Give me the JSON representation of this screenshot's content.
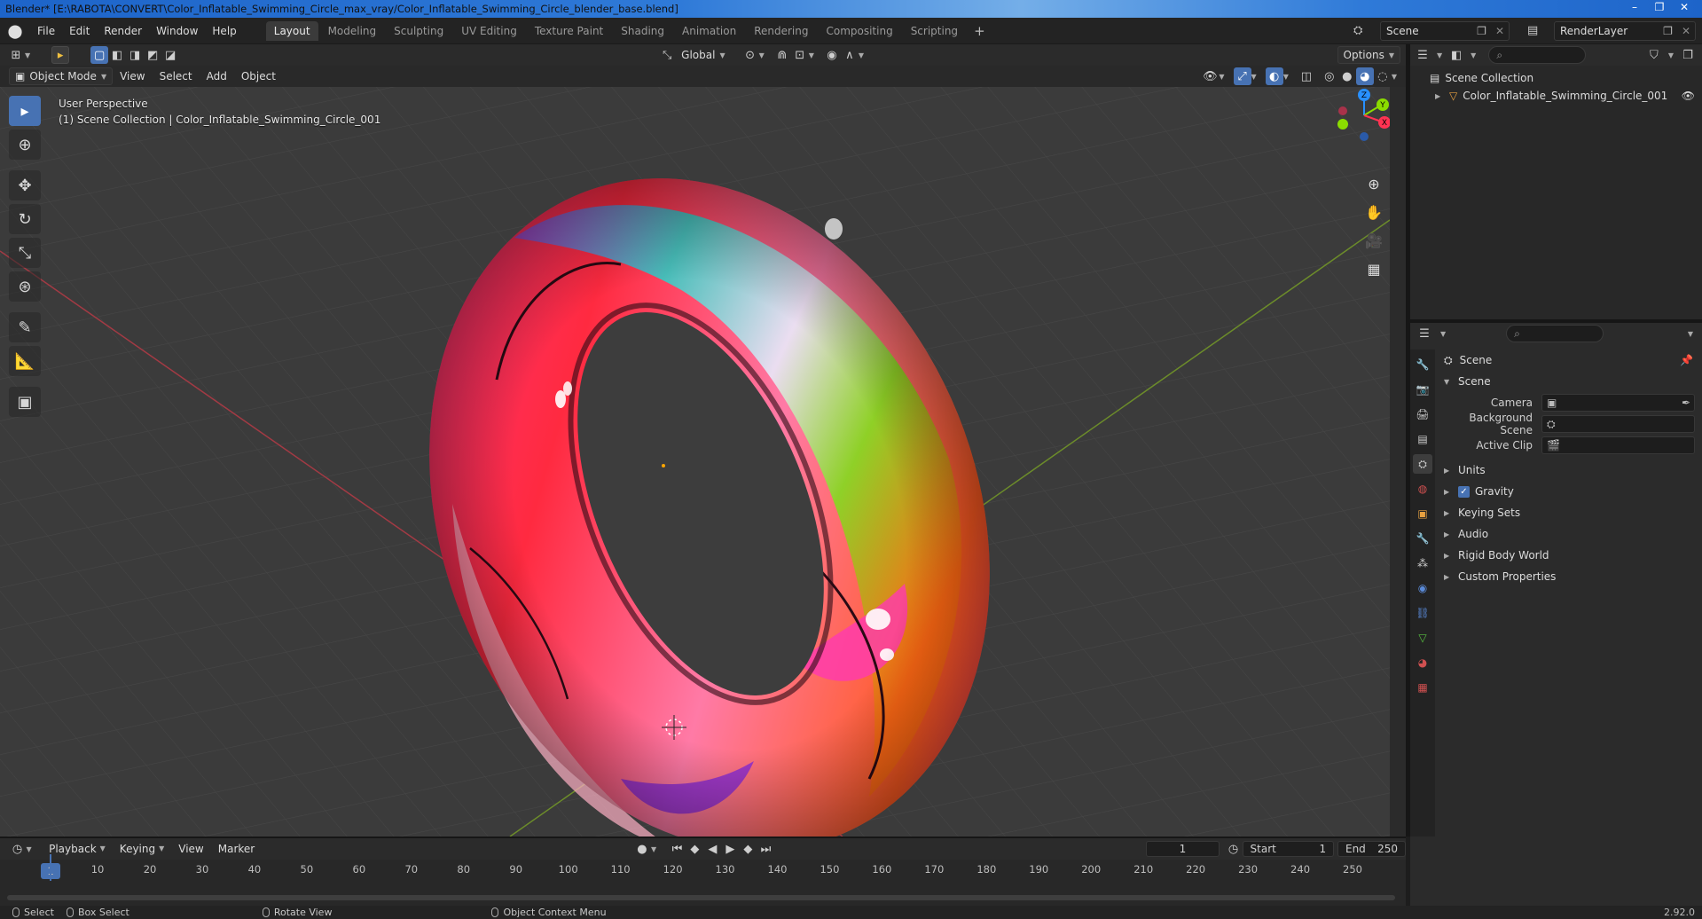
{
  "window": {
    "title": "Blender* [E:\\RABOTA\\CONVERT\\Color_Inflatable_Swimming_Circle_max_vray/Color_Inflatable_Swimming_Circle_blender_base.blend]",
    "min": "–",
    "max": "❐",
    "close": "✕"
  },
  "menu": [
    "File",
    "Edit",
    "Render",
    "Window",
    "Help"
  ],
  "workspaces": [
    "Layout",
    "Modeling",
    "Sculpting",
    "UV Editing",
    "Texture Paint",
    "Shading",
    "Animation",
    "Rendering",
    "Compositing",
    "Scripting"
  ],
  "active_workspace": "Layout",
  "scene_name": "Scene",
  "view_layer": "RenderLayer",
  "toolbar": {
    "orientation": "Global",
    "options": "Options"
  },
  "viewport_header": {
    "mode": "Object Mode",
    "menus": [
      "View",
      "Select",
      "Add",
      "Object"
    ]
  },
  "viewport": {
    "perspective": "User Perspective",
    "collection_info": "(1) Scene Collection | Color_Inflatable_Swimming_Circle_001",
    "gizmo": {
      "z": "Z",
      "y": "Y",
      "x": "X"
    }
  },
  "outliner": {
    "root": "Scene Collection",
    "object": "Color_Inflatable_Swimming_Circle_001"
  },
  "properties": {
    "context": "Scene",
    "panel_scene": "Scene",
    "fields": [
      {
        "label": "Camera",
        "value": ""
      },
      {
        "label": "Background Scene",
        "value": ""
      },
      {
        "label": "Active Clip",
        "value": ""
      }
    ],
    "panels": [
      {
        "label": "Units",
        "check": false
      },
      {
        "label": "Gravity",
        "check": true
      },
      {
        "label": "Keying Sets",
        "check": false
      },
      {
        "label": "Audio",
        "check": false
      },
      {
        "label": "Rigid Body World",
        "check": false
      },
      {
        "label": "Custom Properties",
        "check": false
      }
    ]
  },
  "timeline": {
    "menus": [
      "Playback",
      "Keying",
      "View",
      "Marker"
    ],
    "current_frame": "1",
    "start_label": "Start",
    "start": "1",
    "end_label": "End",
    "end": "250",
    "ruler": [
      "1",
      "10",
      "20",
      "30",
      "40",
      "50",
      "60",
      "70",
      "80",
      "90",
      "100",
      "110",
      "120",
      "130",
      "140",
      "150",
      "160",
      "170",
      "180",
      "190",
      "200",
      "210",
      "220",
      "230",
      "240",
      "250"
    ]
  },
  "statusbar": {
    "select": "Select",
    "box_select": "Box Select",
    "rotate": "Rotate View",
    "context_menu": "Object Context Menu",
    "version": "2.92.0"
  },
  "colors": {
    "accent": "#4772b3",
    "x_axis": "#ff3352",
    "y_axis": "#8bdc00",
    "z_axis": "#2890ff"
  }
}
